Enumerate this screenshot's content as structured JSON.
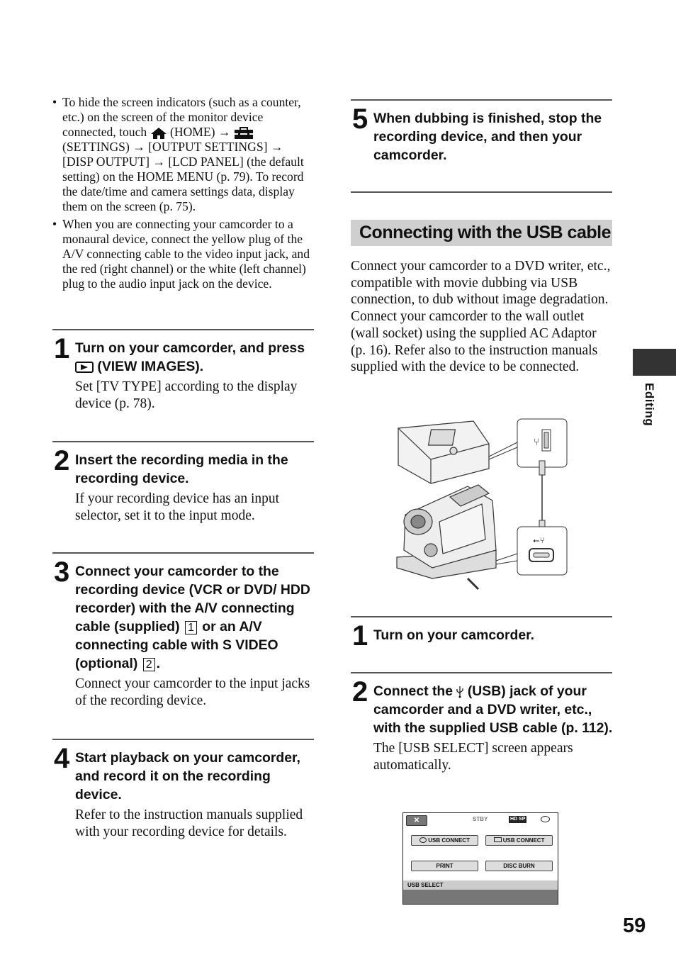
{
  "bullets": [
    {
      "parts": [
        "To hide the screen indicators (such as a counter, etc.) on the screen of the monitor device connected, touch ",
        " (HOME) → ",
        " (SETTINGS) → [OUTPUT SETTINGS] → [DISP OUTPUT] → [LCD PANEL] (the default setting) on the HOME MENU (p. 79). To record the date/time and camera settings data, display them on the screen (p. 75)."
      ]
    },
    {
      "text": "When you are connecting your camcorder to a monaural device, connect the yellow plug of the A/V connecting cable to the video input jack, and the red (right channel) or the white (left channel) plug to the audio input jack on the device."
    }
  ],
  "left_steps": [
    {
      "num": "1",
      "title_a": "Turn on your camcorder, and press ",
      "title_b": " (VIEW IMAGES).",
      "body": "Set [TV TYPE] according to the display device (p. 78)."
    },
    {
      "num": "2",
      "title": "Insert the recording media in the recording device.",
      "body": "If your recording device has an input selector, set it to the input mode."
    },
    {
      "num": "3",
      "title_a": "Connect your camcorder to the recording device (VCR or DVD/ HDD recorder) with the A/V connecting cable (supplied) ",
      "box1": "1",
      "title_b": " or an A/V connecting cable with S VIDEO (optional) ",
      "box2": "2",
      "title_c": ".",
      "body": "Connect your camcorder to the input jacks of the recording device."
    },
    {
      "num": "4",
      "title": "Start playback on your camcorder, and record it on the recording device.",
      "body": "Refer to the instruction manuals supplied with your recording device for details."
    }
  ],
  "right_steps": {
    "step5": {
      "num": "5",
      "title": "When dubbing is finished, stop the recording device, and then your camcorder."
    },
    "usb1": {
      "num": "1",
      "title": "Turn on your camcorder."
    },
    "usb2": {
      "num": "2",
      "title_a": "Connect the ",
      "title_b": " (USB) jack of your camcorder and a DVD writer, etc., with the supplied USB cable (p. 112).",
      "body": "The [USB SELECT] screen appears automatically."
    }
  },
  "section": {
    "heading": "Connecting with the USB cable",
    "intro": [
      "Connect your camcorder to a DVD writer, etc., compatible with movie dubbing via USB connection, to dub without image degradation.",
      "Connect your camcorder to the wall outlet (wall socket) using the supplied AC Adaptor (p. 16). Refer also to the instruction manuals supplied with the device to be connected."
    ]
  },
  "lcd": {
    "close": "✕",
    "status": "STBY",
    "quality": "HD SP",
    "buttons": [
      "USB CONNECT",
      "USB CONNECT",
      "PRINT",
      "DISC BURN"
    ],
    "title": "USB SELECT"
  },
  "side_label": "Editing",
  "page_number": "59",
  "colors": {
    "rule": "#555555",
    "section_bg": "#cfcfcf",
    "side_tab": "#333333"
  }
}
